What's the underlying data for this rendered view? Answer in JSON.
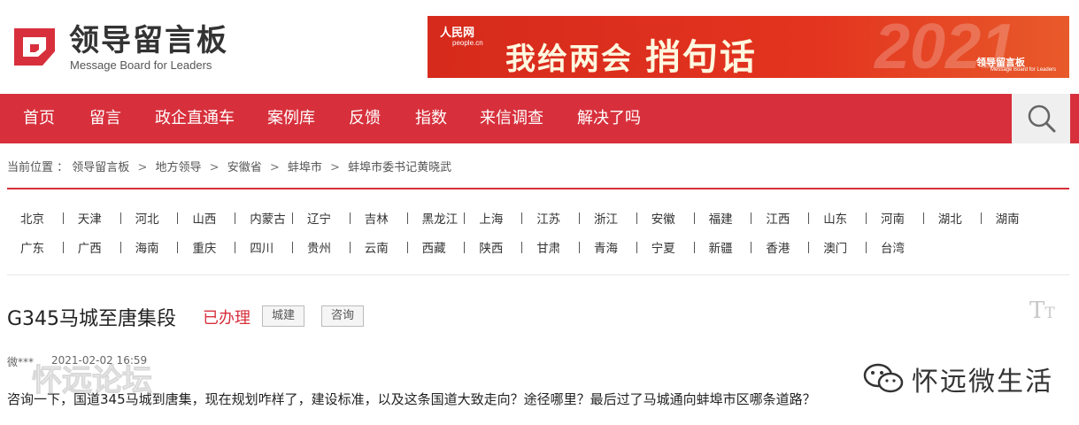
{
  "header": {
    "logo_title": "领导留言板",
    "logo_subtitle": "Message Board for Leaders"
  },
  "banner": {
    "site_name": "人民网",
    "site_domain": "people.cn",
    "headline_part1": "我给两会",
    "headline_part2": "捎句话",
    "year": "2021",
    "brand": "领导留言板",
    "brand_sub": "Message Board for Leaders"
  },
  "nav": {
    "items": [
      "首页",
      "留言",
      "政企直通车",
      "案例库",
      "反馈",
      "指数",
      "来信调查",
      "解决了吗"
    ],
    "search_icon": "search-icon"
  },
  "breadcrumb": {
    "prefix": "当前位置 ：",
    "items": [
      "领导留言板",
      "地方领导",
      "安徽省",
      "蚌埠市",
      "蚌埠市委书记黄晓武"
    ],
    "separator": ">"
  },
  "regions": {
    "row1": [
      "北京",
      "天津",
      "河北",
      "山西",
      "内蒙古",
      "辽宁",
      "吉林",
      "黑龙江",
      "上海",
      "江苏",
      "浙江",
      "安徽",
      "福建",
      "江西",
      "山东",
      "河南",
      "湖北",
      "湖南"
    ],
    "row2": [
      "广东",
      "广西",
      "海南",
      "重庆",
      "四川",
      "贵州",
      "云南",
      "西藏",
      "陕西",
      "甘肃",
      "青海",
      "宁夏",
      "新疆",
      "香港",
      "澳门",
      "台湾"
    ]
  },
  "article": {
    "title": "G345马城至唐集段",
    "status": "已办理",
    "tags": [
      "城建",
      "咨询"
    ],
    "font_tool": "T",
    "author": "微***",
    "time": "2021-02-02 16:59",
    "body": "咨询一下，国道345马城到唐集，现在规划咋样了，建设标准，以及这条国道大致走向？途径哪里？最后过了马城通向蚌埠市区哪条道路？"
  },
  "watermarks": {
    "left": "怀远论坛",
    "right": "怀远微生活"
  },
  "colors": {
    "brand_red": "#d7303c",
    "banner_red": "#e3341f",
    "text_dark": "#222222"
  }
}
